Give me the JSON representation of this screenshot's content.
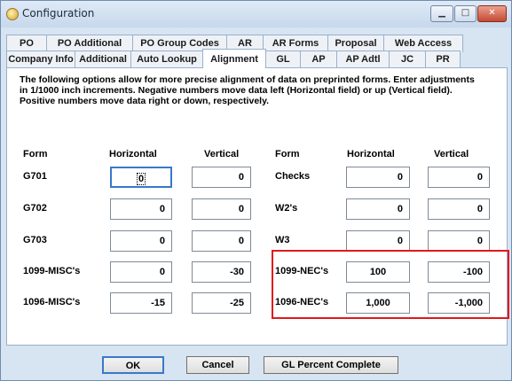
{
  "window": {
    "title": "Configuration"
  },
  "tabs_row1": [
    "PO",
    "PO Additional",
    "PO Group Codes",
    "AR",
    "AR Forms",
    "Proposal",
    "Web Access"
  ],
  "tabs_row2": [
    "Company Info",
    "Additional",
    "Auto Lookup",
    "Alignment",
    "GL",
    "AP",
    "AP Adtl",
    "JC",
    "PR"
  ],
  "active_tab": "Alignment",
  "description": "The following options allow for more precise alignment of data on preprinted forms. Enter adjustments in 1/1000 inch increments. Negative numbers move data left (Horizontal field) or up (Vertical field). Positive numbers move data right or down, respectively.",
  "headers": {
    "form": "Form",
    "horizontal": "Horizontal",
    "vertical": "Vertical"
  },
  "left_rows": [
    {
      "form": "G701",
      "horizontal": "0",
      "vertical": "0"
    },
    {
      "form": "G702",
      "horizontal": "0",
      "vertical": "0"
    },
    {
      "form": "G703",
      "horizontal": "0",
      "vertical": "0"
    },
    {
      "form": "1099-MISC's",
      "horizontal": "0",
      "vertical": "-30"
    },
    {
      "form": "1096-MISC's",
      "horizontal": "-15",
      "vertical": "-25"
    }
  ],
  "right_rows": [
    {
      "form": "Checks",
      "horizontal": "0",
      "vertical": "0"
    },
    {
      "form": "W2's",
      "horizontal": "0",
      "vertical": "0"
    },
    {
      "form": "W3",
      "horizontal": "0",
      "vertical": "0"
    },
    {
      "form": "1099-NEC's",
      "horizontal": "100",
      "vertical": "-100"
    },
    {
      "form": "1096-NEC's",
      "horizontal": "1,000",
      "vertical": "-1,000"
    }
  ],
  "buttons": {
    "ok": "OK",
    "cancel": "Cancel",
    "gl_percent": "GL Percent Complete"
  },
  "colors": {
    "highlight": "#e0191b",
    "focus": "#3a78c9"
  }
}
